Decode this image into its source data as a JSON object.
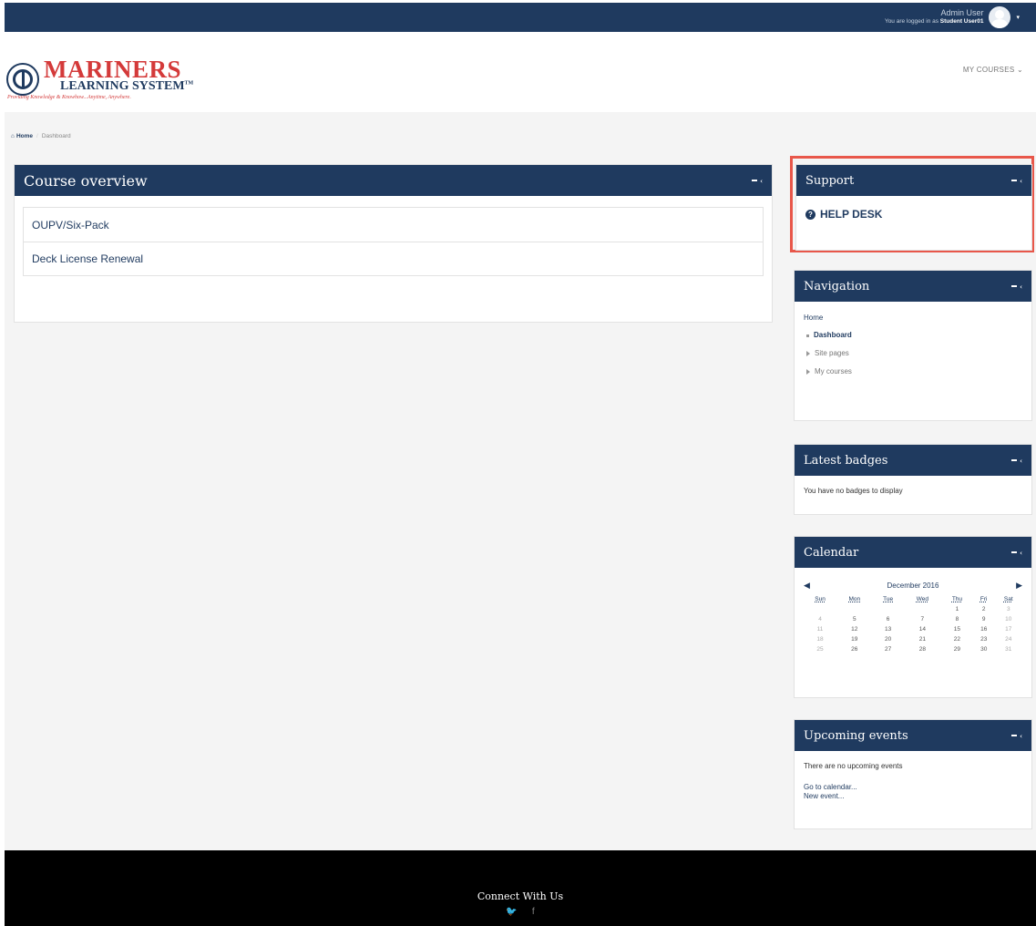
{
  "topbar": {
    "user_name": "Admin User",
    "login_prefix": "You are logged in as",
    "login_user": "Student User01",
    "caret": "▾"
  },
  "header": {
    "logo_title": "MARINERS",
    "logo_subtitle": "LEARNING SYSTEM",
    "logo_tm": "TM",
    "logo_tagline": "Providing Knowledge & Knowhow...Anytime, Anywhere.",
    "my_courses": "MY COURSES ⌄"
  },
  "breadcrumb": {
    "home": "Home",
    "separator": "/",
    "current": "Dashboard"
  },
  "course_overview": {
    "title": "Course overview",
    "courses": [
      "OUPV/Six-Pack",
      "Deck License Renewal"
    ]
  },
  "support": {
    "title": "Support",
    "help_icon": "?",
    "help_desk": "HELP DESK"
  },
  "navigation": {
    "title": "Navigation",
    "home": "Home",
    "items": [
      "Dashboard",
      "Site pages",
      "My courses"
    ]
  },
  "badges": {
    "title": "Latest badges",
    "empty": "You have no badges to display"
  },
  "calendar": {
    "title": "Calendar",
    "month": "December 2016",
    "prev": "◀",
    "next": "▶",
    "weekdays": [
      "Sun",
      "Mon",
      "Tue",
      "Wed",
      "Thu",
      "Fri",
      "Sat"
    ],
    "weeks": [
      [
        "",
        "",
        "",
        "",
        "1",
        "2",
        "3"
      ],
      [
        "4",
        "5",
        "6",
        "7",
        "8",
        "9",
        "10"
      ],
      [
        "11",
        "12",
        "13",
        "14",
        "15",
        "16",
        "17"
      ],
      [
        "18",
        "19",
        "20",
        "21",
        "22",
        "23",
        "24"
      ],
      [
        "25",
        "26",
        "27",
        "28",
        "29",
        "30",
        "31"
      ]
    ]
  },
  "events": {
    "title": "Upcoming events",
    "empty": "There are no upcoming events",
    "go_to_calendar": "Go to calendar...",
    "new_event": "New event..."
  },
  "footer": {
    "title": "Connect With Us",
    "twitter": "🐦",
    "facebook": "f"
  },
  "colors": {
    "brand_navy": "#1f3a5f",
    "brand_red": "#d43a3a",
    "highlight": "#e8574a"
  }
}
